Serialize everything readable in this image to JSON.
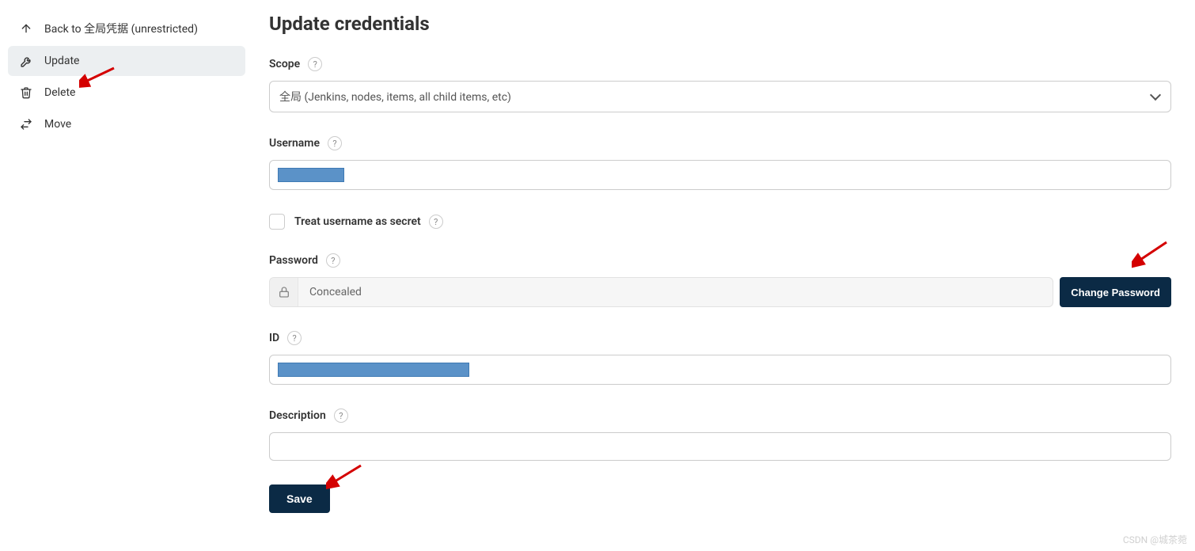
{
  "sidebar": {
    "back": "Back to 全局凭据 (unrestricted)",
    "update": "Update",
    "delete": "Delete",
    "move": "Move"
  },
  "title": "Update credentials",
  "form": {
    "scopeLabel": "Scope",
    "scopeValue": "全局 (Jenkins, nodes, items, all child items, etc)",
    "usernameLabel": "Username",
    "treatSecretLabel": "Treat username as secret",
    "passwordLabel": "Password",
    "passwordValue": "Concealed",
    "changePassword": "Change Password",
    "idLabel": "ID",
    "descriptionLabel": "Description",
    "save": "Save",
    "helpGlyph": "?"
  },
  "watermark": "CSDN @城茶菀"
}
